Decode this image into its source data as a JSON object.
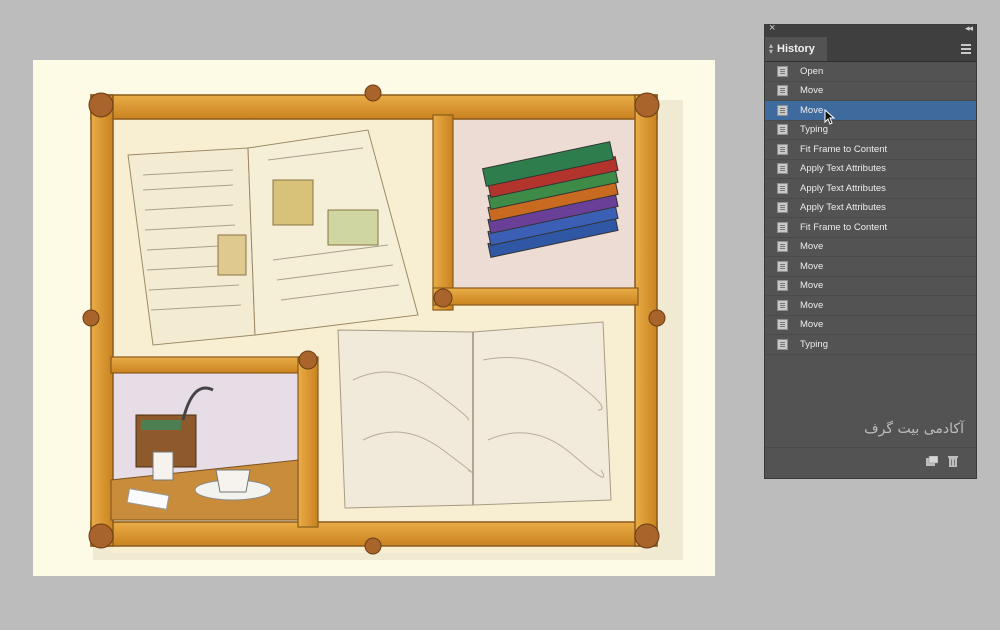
{
  "history_panel": {
    "tab_label": "History",
    "items": [
      {
        "label": "Open",
        "selected": false
      },
      {
        "label": "Move",
        "selected": false
      },
      {
        "label": "Move",
        "selected": true
      },
      {
        "label": "Typing",
        "selected": false
      },
      {
        "label": "Fit Frame to Content",
        "selected": false
      },
      {
        "label": "Apply Text Attributes",
        "selected": false
      },
      {
        "label": "Apply Text Attributes",
        "selected": false
      },
      {
        "label": "Apply Text Attributes",
        "selected": false
      },
      {
        "label": "Fit Frame to Content",
        "selected": false
      },
      {
        "label": "Move",
        "selected": false
      },
      {
        "label": "Move",
        "selected": false
      },
      {
        "label": "Move",
        "selected": false
      },
      {
        "label": "Move",
        "selected": false
      },
      {
        "label": "Move",
        "selected": false
      },
      {
        "label": "Typing",
        "selected": false
      }
    ],
    "watermark": "آکادمی بیت گرف"
  },
  "colors": {
    "app_background": "#bcbcbc",
    "page_background": "#fdfbe6",
    "frame_wood": "#d9962e",
    "panel_background": "#535353",
    "selection": "#3f6a9e"
  }
}
